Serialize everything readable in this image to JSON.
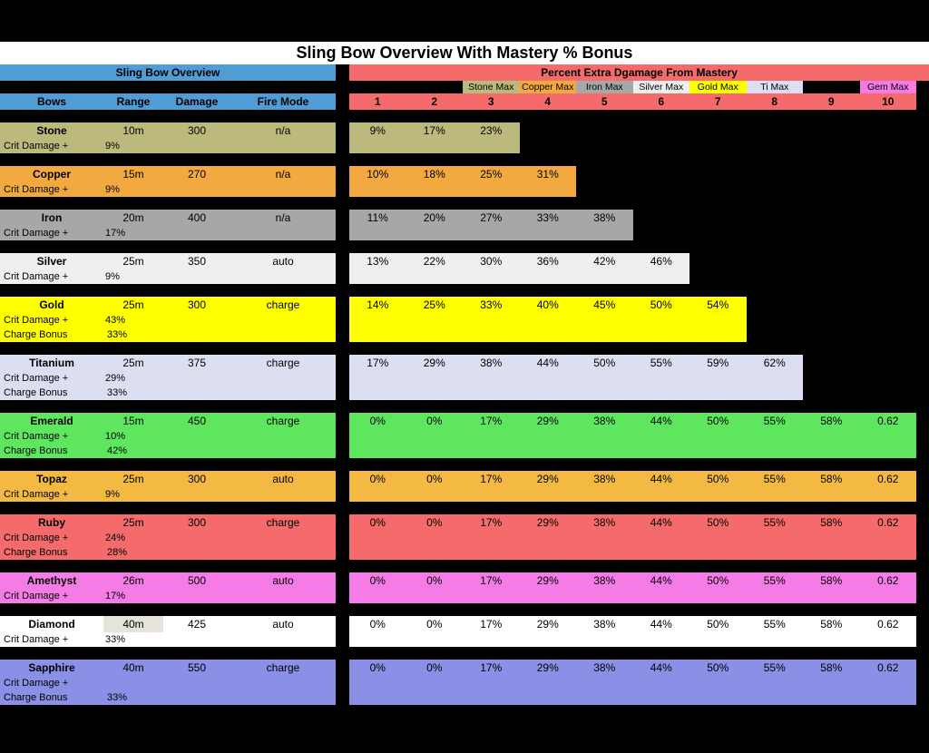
{
  "title": "Sling Bow Overview With Mastery % Bonus",
  "leftHeader": "Sling Bow Overview",
  "rightHeader": "Percent Extra Dgamage From Mastery",
  "columns": {
    "bows": "Bows",
    "range": "Range",
    "damage": "Damage",
    "fireMode": "Fire Mode"
  },
  "masteryNumbers": [
    "1",
    "2",
    "3",
    "4",
    "5",
    "6",
    "7",
    "8",
    "9",
    "10"
  ],
  "critLabel": "Crit Damage +",
  "chargeLabel": "Charge Bonus",
  "maxLabels": [
    {
      "col": 2,
      "text": "Stone Max",
      "bg": "#bcb97c"
    },
    {
      "col": 3,
      "text": "Copper Max",
      "bg": "#f2a940"
    },
    {
      "col": 4,
      "text": "Iron Max",
      "bg": "#a7a7a7"
    },
    {
      "col": 5,
      "text": "Silver Max",
      "bg": "#efefef"
    },
    {
      "col": 6,
      "text": "Gold Max",
      "bg": "#ffff00"
    },
    {
      "col": 7,
      "text": "Ti Max",
      "bg": "#dcdff2"
    },
    {
      "col": 9,
      "text": "Gem Max",
      "bg": "#f57ce6"
    }
  ],
  "bows": [
    {
      "name": "Stone",
      "color": "#bcb97c",
      "range": "10m",
      "damage": "300",
      "fire": "n/a",
      "crit": "9%",
      "charge": null,
      "mastery": [
        "9%",
        "17%",
        "23%"
      ],
      "rows": 2
    },
    {
      "name": "Copper",
      "color": "#f2a940",
      "range": "15m",
      "damage": "270",
      "fire": "n/a",
      "crit": "9%",
      "charge": null,
      "mastery": [
        "10%",
        "18%",
        "25%",
        "31%"
      ],
      "rows": 2
    },
    {
      "name": "Iron",
      "color": "#a7a7a7",
      "range": "20m",
      "damage": "400",
      "fire": "n/a",
      "crit": "17%",
      "charge": null,
      "mastery": [
        "11%",
        "20%",
        "27%",
        "33%",
        "38%"
      ],
      "rows": 2
    },
    {
      "name": "Silver",
      "color": "#efefef",
      "range": "25m",
      "damage": "350",
      "fire": "auto",
      "crit": "9%",
      "charge": null,
      "mastery": [
        "13%",
        "22%",
        "30%",
        "36%",
        "42%",
        "46%"
      ],
      "rows": 2
    },
    {
      "name": "Gold",
      "color": "#ffff00",
      "range": "25m",
      "damage": "300",
      "fire": "charge",
      "crit": "43%",
      "charge": "33%",
      "mastery": [
        "14%",
        "25%",
        "33%",
        "40%",
        "45%",
        "50%",
        "54%"
      ],
      "rows": 3
    },
    {
      "name": "Titanium",
      "color": "#dcdff2",
      "range": "25m",
      "damage": "375",
      "fire": "charge",
      "crit": "29%",
      "charge": "33%",
      "mastery": [
        "17%",
        "29%",
        "38%",
        "44%",
        "50%",
        "55%",
        "59%",
        "62%"
      ],
      "rows": 3
    },
    {
      "name": "Emerald",
      "color": "#5ee65e",
      "range": "15m",
      "damage": "450",
      "fire": "charge",
      "crit": "10%",
      "charge": "42%",
      "mastery": [
        "0%",
        "0%",
        "17%",
        "29%",
        "38%",
        "44%",
        "50%",
        "55%",
        "58%",
        "0.62"
      ],
      "rows": 3
    },
    {
      "name": "Topaz",
      "color": "#f4b942",
      "range": "25m",
      "damage": "300",
      "fire": "auto",
      "crit": "9%",
      "charge": null,
      "mastery": [
        "0%",
        "0%",
        "17%",
        "29%",
        "38%",
        "44%",
        "50%",
        "55%",
        "58%",
        "0.62"
      ],
      "rows": 2
    },
    {
      "name": "Ruby",
      "color": "#f56a6a",
      "range": "25m",
      "damage": "300",
      "fire": "charge",
      "crit": "24%",
      "charge": "28%",
      "mastery": [
        "0%",
        "0%",
        "17%",
        "29%",
        "38%",
        "44%",
        "50%",
        "55%",
        "58%",
        "0.62"
      ],
      "rows": 3
    },
    {
      "name": "Amethyst",
      "color": "#f57ce6",
      "range": "26m",
      "damage": "500",
      "fire": "auto",
      "crit": "17%",
      "charge": null,
      "mastery": [
        "0%",
        "0%",
        "17%",
        "29%",
        "38%",
        "44%",
        "50%",
        "55%",
        "58%",
        "0.62"
      ],
      "rows": 2
    },
    {
      "name": "Diamond",
      "color": "#ffffff",
      "range": "40m",
      "damage": "425",
      "fire": "auto",
      "crit": "33%",
      "charge": null,
      "mastery": [
        "0%",
        "0%",
        "17%",
        "29%",
        "38%",
        "44%",
        "50%",
        "55%",
        "58%",
        "0.62"
      ],
      "rows": 2,
      "rangeBg": "#e6e3da"
    },
    {
      "name": "Sapphire",
      "color": "#8a90e6",
      "range": "40m",
      "damage": "550",
      "fire": "charge",
      "crit": "",
      "charge": "33%",
      "mastery": [
        "0%",
        "0%",
        "17%",
        "29%",
        "38%",
        "44%",
        "50%",
        "55%",
        "58%",
        "0.62"
      ],
      "rows": 3
    }
  ]
}
